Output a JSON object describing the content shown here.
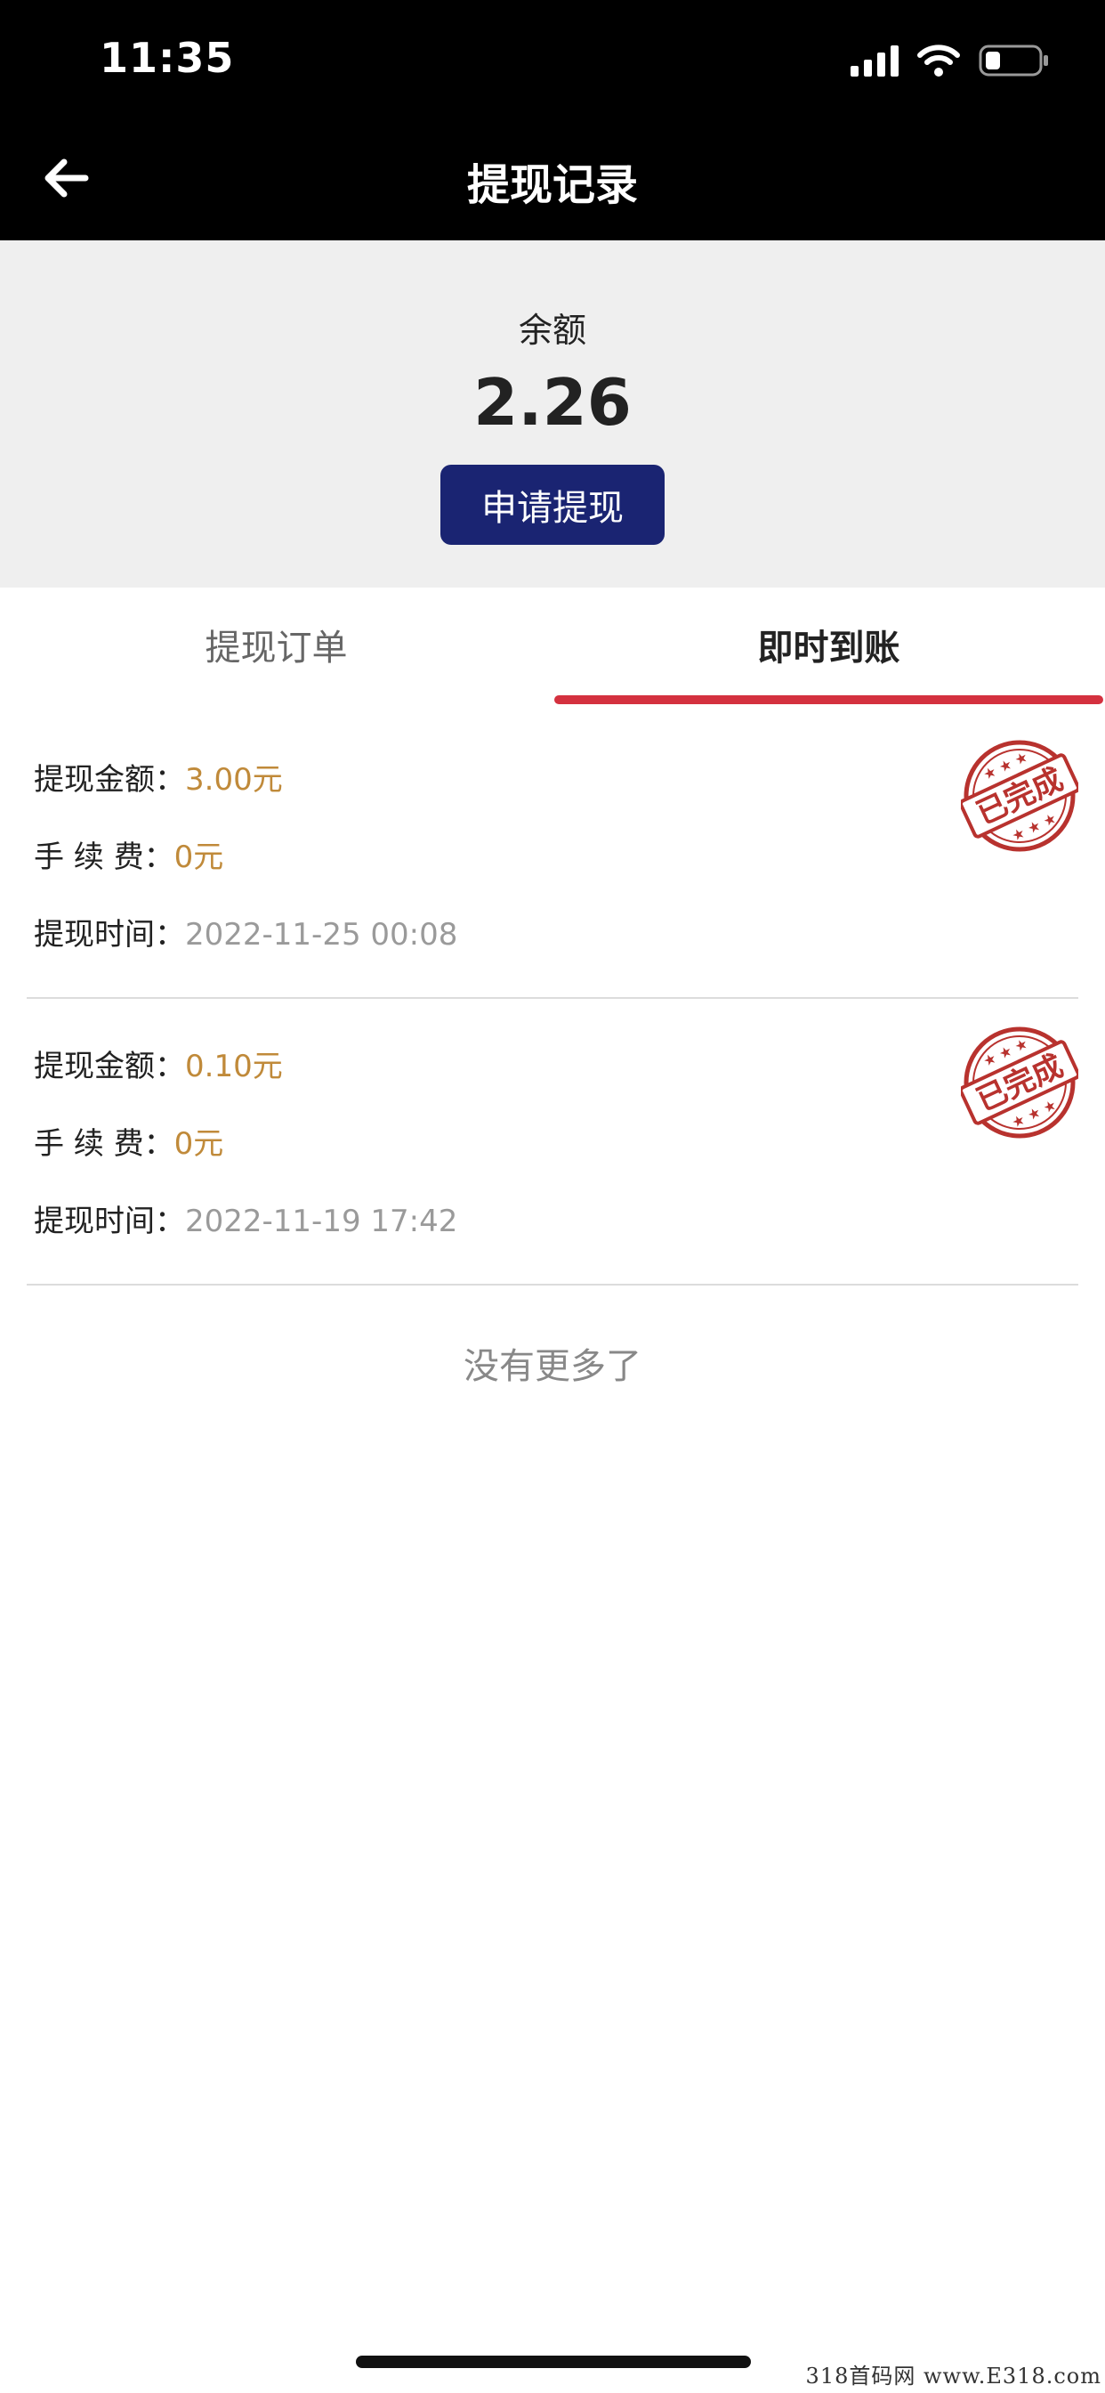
{
  "status": {
    "time": "11:35"
  },
  "nav": {
    "title": "提现记录",
    "back_icon": "arrow-left-icon"
  },
  "balance": {
    "label": "余额",
    "value": "2.26",
    "button_label": "申请提现"
  },
  "tabs": [
    {
      "label": "提现订单",
      "active": false
    },
    {
      "label": "即时到账",
      "active": true
    }
  ],
  "records": [
    {
      "amount_label": "提现金额：",
      "amount": "3.00元",
      "fee_label": "手 续 费：",
      "fee": "0元",
      "time_label": "提现时间：",
      "time": "2022-11-25 00:08",
      "stamp_text": "已完成"
    },
    {
      "amount_label": "提现金额：",
      "amount": "0.10元",
      "fee_label": "手 续 费：",
      "fee": "0元",
      "time_label": "提现时间：",
      "time": "2022-11-19 17:42",
      "stamp_text": "已完成"
    }
  ],
  "footer": {
    "no_more": "没有更多了"
  },
  "watermark": "318首码网 www.E318.com",
  "colors": {
    "accent_blue": "#1a2472",
    "tab_underline": "#d4313f",
    "amount": "#c08a3a",
    "stamp": "#b8322e"
  }
}
